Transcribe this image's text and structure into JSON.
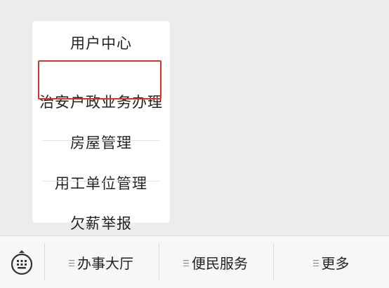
{
  "popup_menu": {
    "items": [
      {
        "label": "用户中心"
      },
      {
        "label": "治安户政业务办理",
        "highlighted": true
      },
      {
        "label": "房屋管理"
      },
      {
        "label": "用工单位管理"
      },
      {
        "label": "欠薪举报"
      }
    ]
  },
  "bottom_bar": {
    "keyboard_icon": "keyboard-icon",
    "tabs": [
      {
        "label": "办事大厅",
        "icon": "menu-lines-icon"
      },
      {
        "label": "便民服务",
        "icon": "menu-lines-icon"
      },
      {
        "label": "更多",
        "icon": "menu-lines-icon"
      }
    ]
  },
  "colors": {
    "highlight_border": "#d8342c",
    "background": "#ececec",
    "popup_background": "#ffffff"
  }
}
